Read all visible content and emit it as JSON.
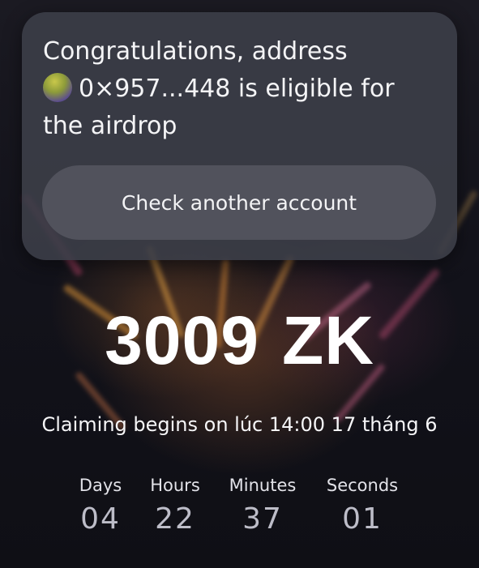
{
  "card": {
    "message_before": "Congratulations, address",
    "address": "0×957...448",
    "message_after": "is eligible for the airdrop",
    "check_button_label": "Check another account"
  },
  "amount": {
    "value": "3009",
    "token": "ZK"
  },
  "claiming_text": "Claiming begins on lúc 14:00 17 tháng 6",
  "countdown": {
    "days": {
      "label": "Days",
      "value": "04"
    },
    "hours": {
      "label": "Hours",
      "value": "22"
    },
    "minutes": {
      "label": "Minutes",
      "value": "37"
    },
    "seconds": {
      "label": "Seconds",
      "value": "01"
    }
  }
}
